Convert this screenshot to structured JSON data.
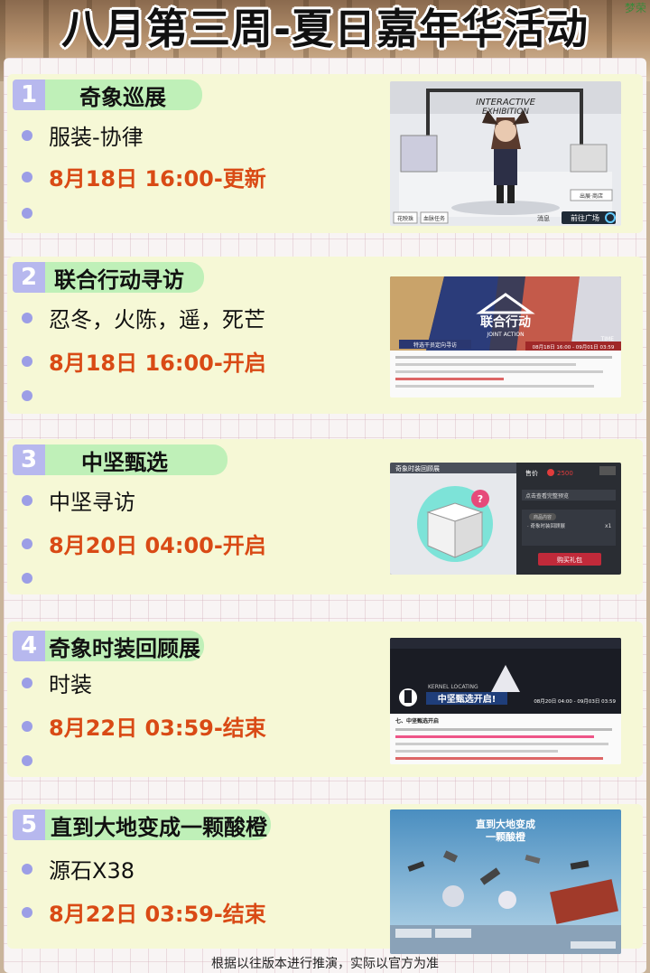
{
  "page": {
    "title": "八月第三周-夏日嘉年华活动",
    "corner_tag": "梦荣",
    "footer": "根据以往版本进行推演，实际以官方为准"
  },
  "sections": [
    {
      "num": "1",
      "label": "奇象巡展",
      "items": [
        "服装-协律",
        "8月18日 16:00-更新",
        ""
      ],
      "shot": {
        "banner_line1": "INTERACTIVE",
        "banner_line2": "EXHIBITION",
        "button_enter": "前往广场",
        "button_a": "花映珠",
        "button_b": "血脉任务",
        "button_c": "出展·商店",
        "button_d": "消息"
      }
    },
    {
      "num": "2",
      "label": "联合行动寻访",
      "items": [
        "忍冬，火陈，遥，死芒",
        "8月18日 16:00-开启",
        ""
      ],
      "shot": {
        "logo_cn": "联合行动",
        "logo_en": "JOINT ACTION",
        "date": "08月18日 16:00 - 09月01日 03:59",
        "caption": "特选干员定向寻访",
        "time_tag": "TIME"
      }
    },
    {
      "num": "3",
      "label": "中坚甄选",
      "items": [
        "中坚寻访",
        "8月20日 04:00-开启",
        ""
      ],
      "shot": {
        "box_title": "奇象时装回顾展",
        "price_label": "售价",
        "price": "2500",
        "panel_title": "点击查看完整预览",
        "sub_label": "商品内容",
        "item": "· 奇象时装回顾展",
        "qty": "x1",
        "buy": "购买礼包"
      }
    },
    {
      "num": "4",
      "label": "奇象时装回顾展",
      "items": [
        "时装",
        "8月22日 03:59-结束",
        ""
      ],
      "shot": {
        "locating": "KERNEL LOCATING",
        "headline": "中坚甄选开启!",
        "date": "08月20日 04:00 - 09月03日 03:59",
        "section": "七、中坚甄选开启"
      }
    },
    {
      "num": "5",
      "label": "直到大地变成一颗酸橙",
      "items": [
        "源石X38",
        "8月22日 03:59-结束",
        ""
      ],
      "shot": {
        "title_line1": "直到大地变成",
        "title_line2": "一颗酸橙"
      }
    }
  ],
  "colors": {
    "accent_red": "#d94a15",
    "tag_green": "#bff0b8",
    "num_purple": "#b7b8ee",
    "card_bg": "#f6f8d6"
  }
}
